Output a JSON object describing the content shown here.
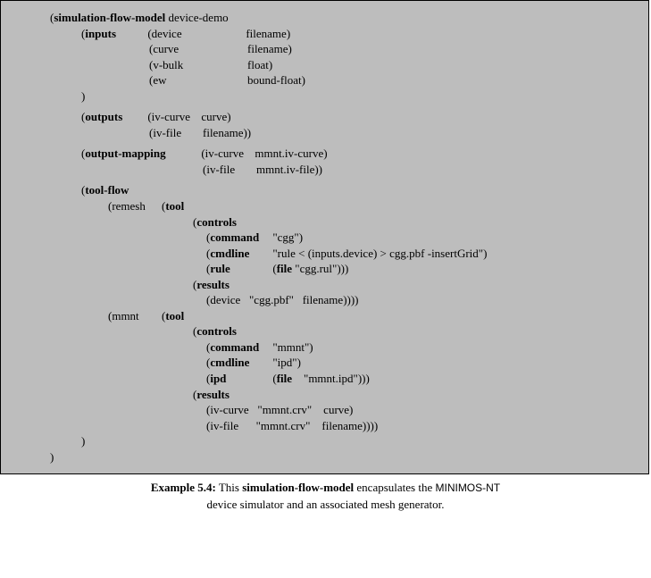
{
  "header": {
    "keyword": "simulation-flow-model",
    "name": "device-demo"
  },
  "inputs": {
    "keyword": "inputs",
    "rows": [
      {
        "name": "(device",
        "type": "filename)"
      },
      {
        "name": "(curve",
        "type": "filename)"
      },
      {
        "name": "(v-bulk",
        "type": "float)"
      },
      {
        "name": "(ew",
        "type": "bound-float)"
      }
    ]
  },
  "outputs": {
    "keyword": "outputs",
    "rows": [
      {
        "name": "(iv-curve",
        "type": "curve)"
      },
      {
        "name": "(iv-file",
        "type": "filename))"
      }
    ]
  },
  "output_mapping": {
    "keyword": "output-mapping",
    "rows": [
      {
        "name": "(iv-curve",
        "value": "mmnt.iv-curve)"
      },
      {
        "name": "(iv-file",
        "value": "mmnt.iv-file))"
      }
    ]
  },
  "toolflow": {
    "keyword": "tool-flow",
    "tools": [
      {
        "name": "(remesh",
        "tool_kw": "tool",
        "controls": {
          "kw": "controls",
          "rows": [
            {
              "k": "command",
              "v": "\"cgg\")"
            },
            {
              "k": "cmdline",
              "v": "\"rule < (inputs.device) > cgg.pbf -insertGrid\")"
            },
            {
              "k": "rule",
              "v_pre": "(",
              "v_kw": "file",
              "v_post": " \"cgg.rul\")))"
            }
          ]
        },
        "results": {
          "kw": "results",
          "rows": [
            {
              "line": "(device   \"cgg.pbf\"   filename))))"
            }
          ]
        }
      },
      {
        "name": "(mmnt",
        "tool_kw": "tool",
        "controls": {
          "kw": "controls",
          "rows": [
            {
              "k": "command",
              "v": "\"mmnt\")"
            },
            {
              "k": "cmdline",
              "v": "\"ipd\")"
            },
            {
              "k": "ipd",
              "v_pre": "(",
              "v_kw": "file",
              "v_post": "    \"mmnt.ipd\")))"
            }
          ]
        },
        "results": {
          "kw": "results",
          "rows": [
            {
              "line": "(iv-curve   \"mmnt.crv\"    curve)"
            },
            {
              "line": "(iv-file      \"mmnt.crv\"    filename))))"
            }
          ]
        }
      }
    ]
  },
  "closing_paren1": ")",
  "closing_paren2": ")",
  "caption": {
    "label": "Example 5.4:",
    "text1": " This ",
    "kw": "simulation-flow-model",
    "text2": " encapsulates the ",
    "tool": "MINIMOS-NT",
    "text3": "device simulator and an associated mesh generator."
  }
}
